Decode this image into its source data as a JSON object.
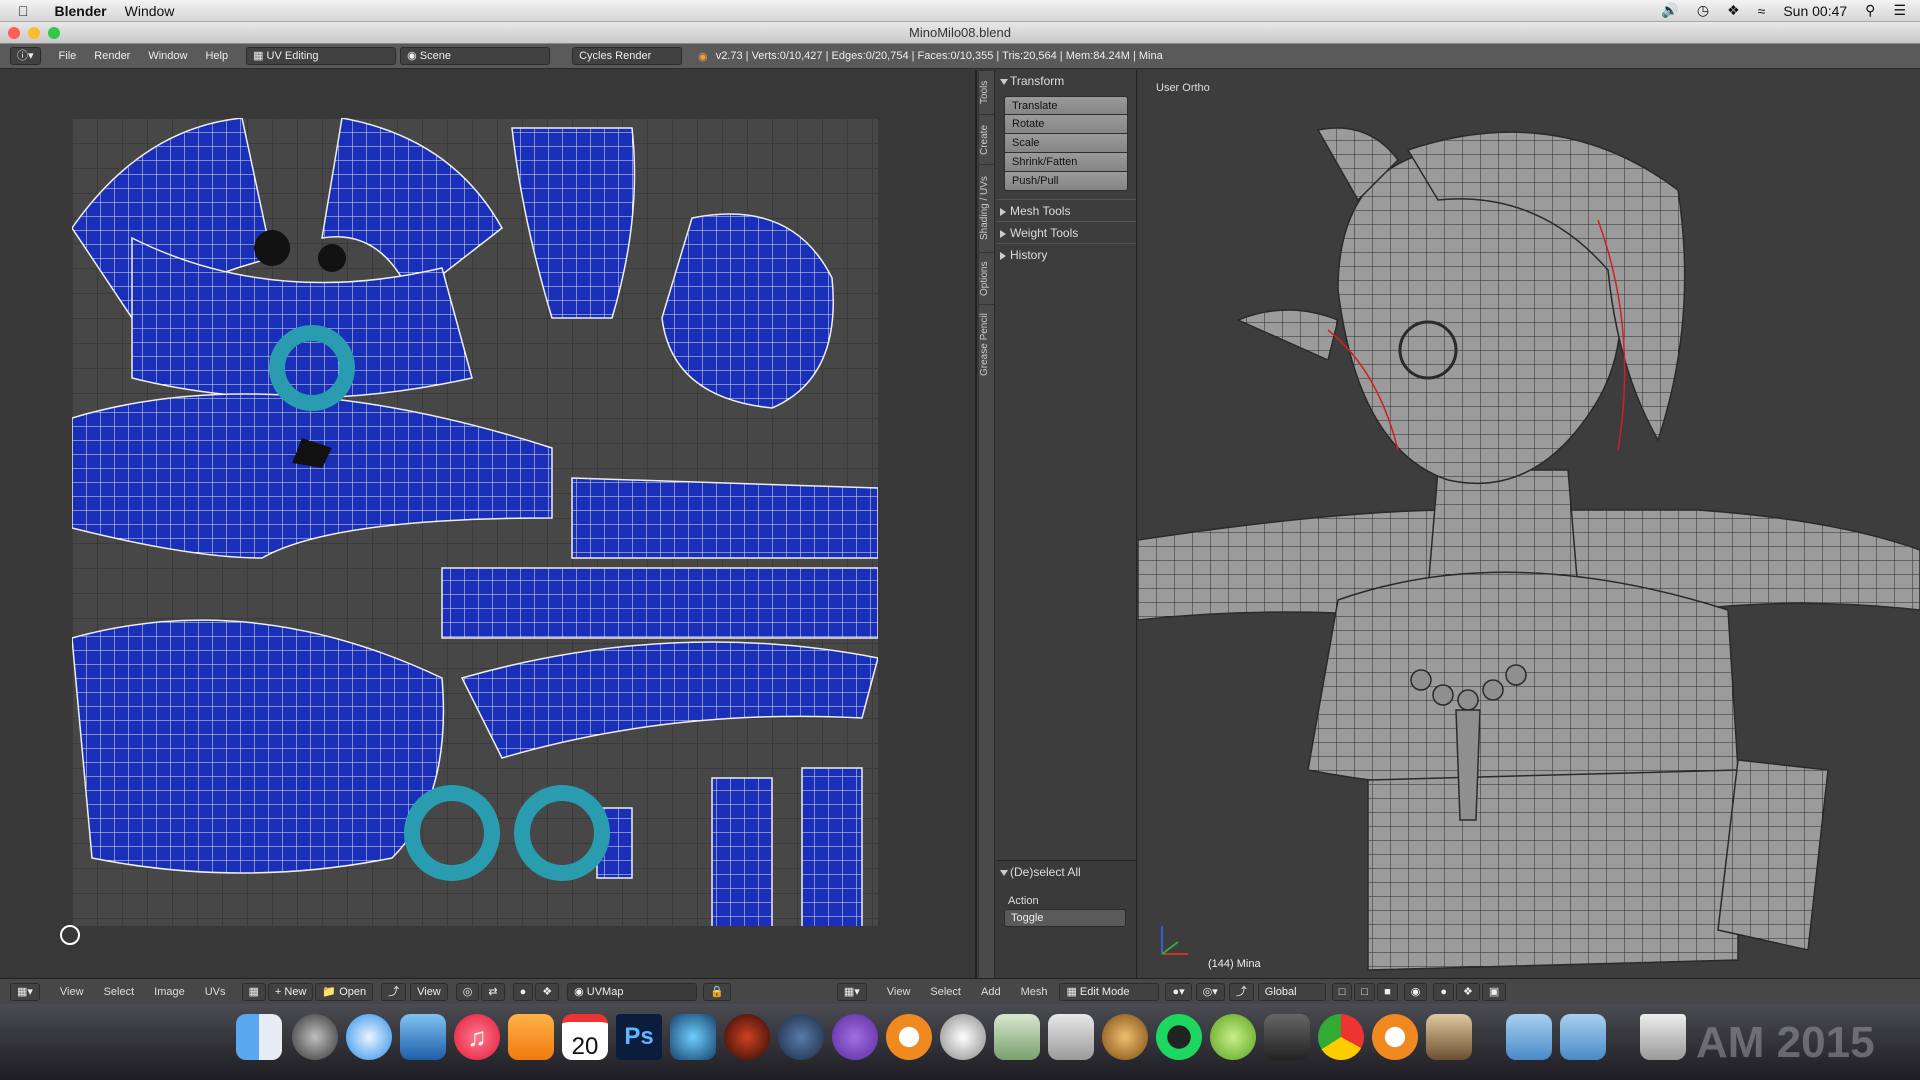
{
  "menubar": {
    "app": "Blender",
    "menu": "Window",
    "clock": "Sun 00:47"
  },
  "window": {
    "title": "MinoMilo08.blend"
  },
  "info": {
    "menus": [
      "File",
      "Render",
      "Window",
      "Help"
    ],
    "layout": "UV Editing",
    "scene": "Scene",
    "engine": "Cycles Render",
    "stats": "v2.73 | Verts:0/10,427 | Edges:0/20,754 | Faces:0/10,355 | Tris:20,564 | Mem:84.24M | Mina"
  },
  "tabs": [
    "Tools",
    "Create",
    "Shading / UVs",
    "Options",
    "Grease Pencil"
  ],
  "toolshelf": {
    "transform": "Transform",
    "buttons": [
      "Translate",
      "Rotate",
      "Scale",
      "Shrink/Fatten",
      "Push/Pull"
    ],
    "panels": [
      "Mesh Tools",
      "Weight Tools",
      "History"
    ],
    "operator": "(De)select All",
    "action_label": "Action",
    "action_value": "Toggle"
  },
  "viewport": {
    "label": "User Ortho",
    "object": "(144) Mina",
    "axes": [
      "z",
      "x",
      "y"
    ]
  },
  "uvfooter": {
    "menus": [
      "View",
      "Select",
      "Image",
      "UVs"
    ],
    "new": "New",
    "open": "Open",
    "view": "View",
    "uvmap": "UVMap"
  },
  "v3dfooter": {
    "menus": [
      "View",
      "Select",
      "Add",
      "Mesh"
    ],
    "mode": "Edit Mode",
    "orientation": "Global"
  },
  "dock": {
    "date": "20",
    "ps": "Ps",
    "watermark": "AM 2015"
  },
  "colors": {
    "uv_fill": "#1a2fb8",
    "uv_edge": "#e8e8e8",
    "mesh": "#9a9a9a",
    "seam": "#d02020"
  }
}
